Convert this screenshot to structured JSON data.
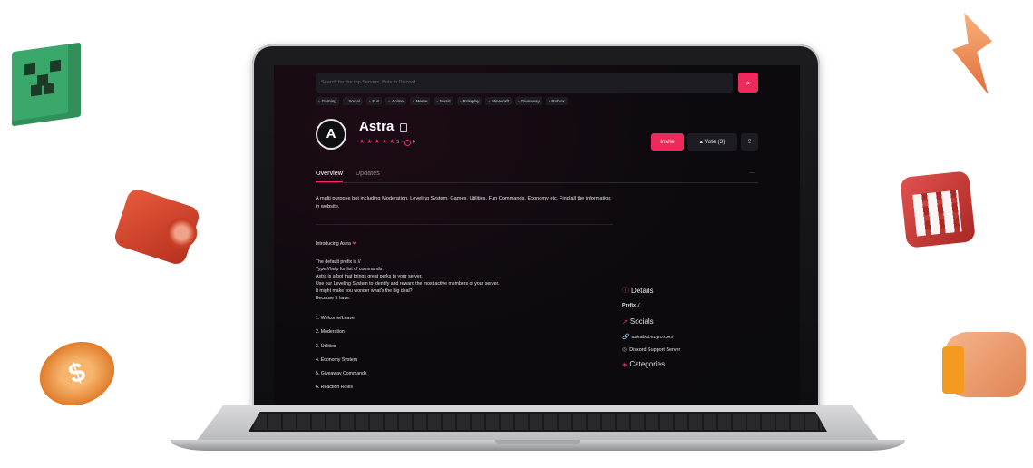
{
  "search": {
    "placeholder": "Search for the top Servers, Bots in Discord..."
  },
  "tags": [
    "Gaming",
    "Social",
    "Fun",
    "Anime",
    "Meme",
    "Music",
    "Roleplay",
    "Minecraft",
    "Giveaway",
    "Roblox"
  ],
  "bot": {
    "name": "Astra",
    "rating": "5",
    "reviews": "0",
    "actions": {
      "invite": "Invite",
      "vote": "Vote (3)"
    }
  },
  "tabs": {
    "overview": "Overview",
    "updates": "Updates",
    "more": "..."
  },
  "description": "A multi purpose bot including Moderation, Leveling System, Games, Utilities, Fun Commands, Economy etc. Find all the information in website.",
  "intro": {
    "heading": "Introducing Astra",
    "lines": [
      "The default prefix is //",
      "Type //help for list of commands.",
      "Astra is a bot that brings great perks to your server.",
      "Use our Leveling System to identify and reward the most active members of your server.",
      "It might make you wonder what's the big deal?",
      "Because it have:"
    ],
    "features": [
      "1. Welcome/Leave",
      "2. Moderation",
      "3. Utilities",
      "4. Economy System",
      "5. Giveaway Commands",
      "6. Reaction Roles"
    ]
  },
  "sidebar": {
    "details_title": "Details",
    "prefix_label": "Prefix",
    "prefix_value": "//",
    "socials_title": "Socials",
    "website": "astrabot.ezyro.com",
    "discord": "Discord Support Server",
    "categories_title": "Categories"
  },
  "colors": {
    "accent": "#ee2a5c",
    "background": "#0c0a0f"
  }
}
